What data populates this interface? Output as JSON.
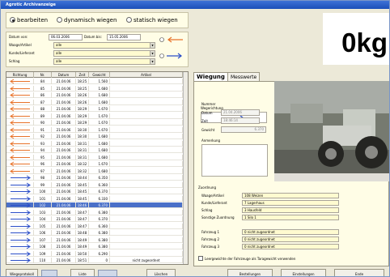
{
  "window": {
    "title": "Agrotic Archivanzeige"
  },
  "mode": {
    "options": [
      "bearbeiten",
      "dynamisch wiegen",
      "statisch wiegen"
    ],
    "selected": "bearbeiten"
  },
  "filters": {
    "datum_von_label": "Datum von:",
    "datum_von": "06.03.2006",
    "datum_bis_label": "Datum bis:",
    "datum_bis": "15.05.2006",
    "waage_label": "Waage/Artikel",
    "waage": "alle",
    "kunde_label": "Kunde/Lieferant",
    "kunde": "alle",
    "schlag_label": "Schlag",
    "schlag": "alle"
  },
  "weight": {
    "value": "0",
    "unit": "kg"
  },
  "grid": {
    "columns": [
      "Richtung",
      "Nr.",
      "Datum",
      "Zeit",
      "Gewicht",
      "Artikel"
    ],
    "rows": [
      {
        "dir": "left",
        "nr": "84",
        "date": "21.04.06",
        "time": "18:25",
        "weight": "1.560",
        "article": ""
      },
      {
        "dir": "left",
        "nr": "85",
        "date": "21.04.06",
        "time": "18:25",
        "weight": "1.680",
        "article": ""
      },
      {
        "dir": "left",
        "nr": "86",
        "date": "21.04.06",
        "time": "18:26",
        "weight": "1.680",
        "article": ""
      },
      {
        "dir": "left",
        "nr": "87",
        "date": "21.04.06",
        "time": "18:26",
        "weight": "1.680",
        "article": ""
      },
      {
        "dir": "left",
        "nr": "88",
        "date": "21.04.06",
        "time": "18:29",
        "weight": "1.670",
        "article": ""
      },
      {
        "dir": "left",
        "nr": "89",
        "date": "21.04.06",
        "time": "18:29",
        "weight": "1.670",
        "article": ""
      },
      {
        "dir": "left",
        "nr": "90",
        "date": "21.04.06",
        "time": "18:29",
        "weight": "1.670",
        "article": ""
      },
      {
        "dir": "left",
        "nr": "91",
        "date": "21.04.06",
        "time": "18:30",
        "weight": "1.670",
        "article": ""
      },
      {
        "dir": "left",
        "nr": "92",
        "date": "21.04.06",
        "time": "18:30",
        "weight": "1.680",
        "article": ""
      },
      {
        "dir": "left",
        "nr": "93",
        "date": "21.04.06",
        "time": "18:31",
        "weight": "1.680",
        "article": ""
      },
      {
        "dir": "left",
        "nr": "94",
        "date": "21.04.06",
        "time": "18:31",
        "weight": "1.680",
        "article": ""
      },
      {
        "dir": "left",
        "nr": "95",
        "date": "21.04.06",
        "time": "18:31",
        "weight": "1.680",
        "article": ""
      },
      {
        "dir": "left",
        "nr": "96",
        "date": "21.04.06",
        "time": "18:32",
        "weight": "1.670",
        "article": ""
      },
      {
        "dir": "left",
        "nr": "97",
        "date": "21.04.06",
        "time": "18:32",
        "weight": "1.680",
        "article": ""
      },
      {
        "dir": "right",
        "nr": "98",
        "date": "21.04.06",
        "time": "18:44",
        "weight": "6.350",
        "article": ""
      },
      {
        "dir": "right",
        "nr": "99",
        "date": "21.04.06",
        "time": "18:45",
        "weight": "6.360",
        "article": ""
      },
      {
        "dir": "right",
        "nr": "100",
        "date": "21.04.06",
        "time": "18:45",
        "weight": "6.370",
        "article": ""
      },
      {
        "dir": "right",
        "nr": "101",
        "date": "21.04.06",
        "time": "18:45",
        "weight": "6.330",
        "article": ""
      },
      {
        "dir": "right",
        "nr": "102",
        "date": "21.04.06",
        "time": "18:46",
        "weight": "6.370",
        "article": "",
        "selected": true
      },
      {
        "dir": "right",
        "nr": "103",
        "date": "21.04.06",
        "time": "18:47",
        "weight": "6.380",
        "article": ""
      },
      {
        "dir": "right",
        "nr": "104",
        "date": "21.04.06",
        "time": "18:47",
        "weight": "6.370",
        "article": ""
      },
      {
        "dir": "right",
        "nr": "105",
        "date": "21.04.06",
        "time": "18:47",
        "weight": "6.360",
        "article": ""
      },
      {
        "dir": "right",
        "nr": "106",
        "date": "21.04.06",
        "time": "18:48",
        "weight": "6.380",
        "article": ""
      },
      {
        "dir": "right",
        "nr": "107",
        "date": "21.04.06",
        "time": "18:49",
        "weight": "6.380",
        "article": ""
      },
      {
        "dir": "right",
        "nr": "108",
        "date": "21.04.06",
        "time": "18:49",
        "weight": "6.380",
        "article": ""
      },
      {
        "dir": "right",
        "nr": "109",
        "date": "21.04.06",
        "time": "18:50",
        "weight": "6.290",
        "article": ""
      },
      {
        "dir": "right",
        "nr": "110",
        "date": "21.04.06",
        "time": "18:51",
        "weight": "0",
        "article": "nicht zugeordnet"
      }
    ]
  },
  "tabs": [
    "Wiegung",
    "Messwerte"
  ],
  "detail": {
    "richtung_label": "Wegerichtung",
    "nummer_label": "Nummer",
    "datum_label": "Datum",
    "datum": "21.04.2006",
    "zeit_label": "Zeit",
    "zeit": "18:46:14",
    "gewicht_label": "Gewicht",
    "gewicht": "6.370",
    "anmerkung_label": "Anmerkung"
  },
  "zuordnung": {
    "title": "Zuordnung",
    "rows": [
      {
        "label": "Waage/Artikel",
        "value": "108 Weizen"
      },
      {
        "label": "Kunde/Lieferant",
        "value": "7 Lagerhaus"
      },
      {
        "label": "Schlag",
        "value": "3 Hausfeld"
      },
      {
        "label": "Sonstige Zuordnung",
        "value": "1 Silo 1"
      }
    ]
  },
  "fahrzeuge": [
    {
      "label": "Fahrzeug 1",
      "value": "0 nicht zugeordnet"
    },
    {
      "label": "Fahrzeug 2",
      "value": "0 nicht zugeordnet"
    },
    {
      "label": "Fahrzeug 3",
      "value": "0 nicht zugeordnet"
    }
  ],
  "checkbox_label": "Leergewichte der Fahrzeuge als Taragewicht verwenden",
  "buttons": [
    "Wiegeprotokoll",
    "Liste",
    "Löschen",
    "Bestellungen",
    "Einstellungen",
    "Ende"
  ],
  "colors": {
    "arrow_left": "#e8732a",
    "arrow_right": "#2c4fc8",
    "selected_row": "#4a70c8",
    "yellow_field": "#fffbd0"
  }
}
